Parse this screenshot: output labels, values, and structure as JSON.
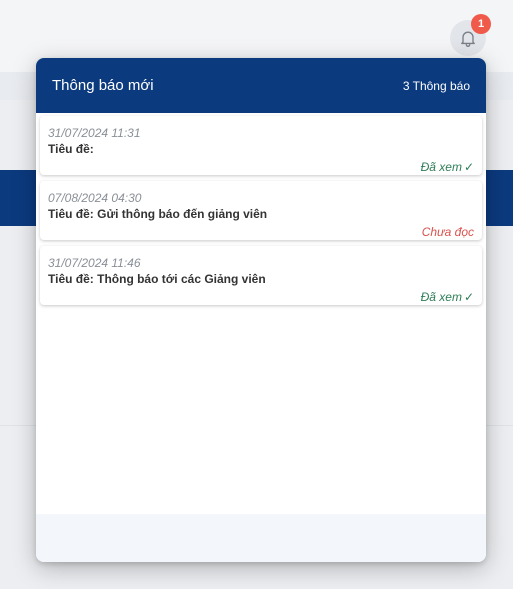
{
  "notifications": {
    "badge_count": "1",
    "header_title": "Thông báo mới",
    "header_count": "3 Thông báo",
    "items": [
      {
        "date": "31/07/2024 11:31",
        "title": "Tiêu đề:",
        "status": "Đã xem",
        "read": true
      },
      {
        "date": "07/08/2024 04:30",
        "title": "Tiêu đề: Gửi thông báo đến giảng viên",
        "status": "Chưa đọc",
        "read": false
      },
      {
        "date": "31/07/2024 11:46",
        "title": "Tiêu đề: Thông báo tới các Giảng viên",
        "status": "Đã xem",
        "read": true
      }
    ]
  },
  "colors": {
    "header_bg": "#0b3a7e",
    "badge": "#f05a4a",
    "read_status": "#2e7d58",
    "unread_status": "#d9534f"
  },
  "icons": {
    "bell": "bell-icon",
    "check": "check-icon"
  }
}
